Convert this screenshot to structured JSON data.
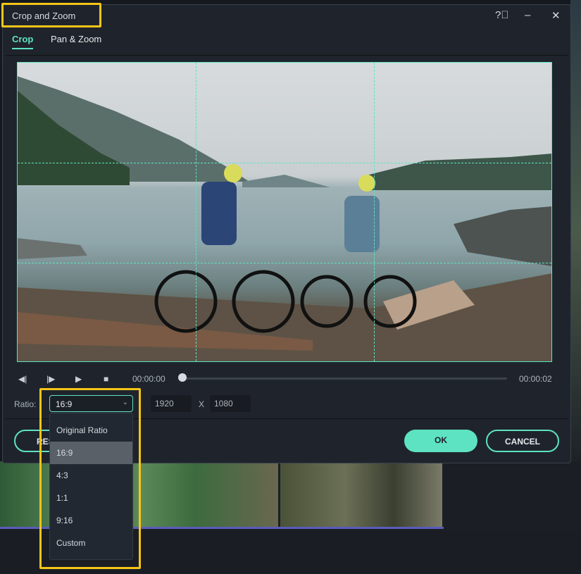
{
  "dialog": {
    "title": "Crop and Zoom",
    "help_icon": "help-circle-icon",
    "minimize_icon": "minimize-icon",
    "close_icon": "close-icon"
  },
  "tabs": [
    {
      "label": "Crop",
      "active": true
    },
    {
      "label": "Pan & Zoom",
      "active": false
    }
  ],
  "playback": {
    "current_time": "00:00:00",
    "end_time": "00:00:02",
    "progress": 0
  },
  "ratio": {
    "label": "Ratio:",
    "selected": "16:9",
    "width": "1920",
    "separator": "X",
    "height": "1080",
    "options": [
      "Original Ratio",
      "16:9",
      "4:3",
      "1:1",
      "9:16",
      "Custom"
    ]
  },
  "buttons": {
    "reset": "RESET",
    "ok": "OK",
    "cancel": "CANCEL"
  },
  "colors": {
    "accent": "#5ee3c2",
    "highlight": "#f5c518",
    "dialog_bg": "#1f242c"
  }
}
